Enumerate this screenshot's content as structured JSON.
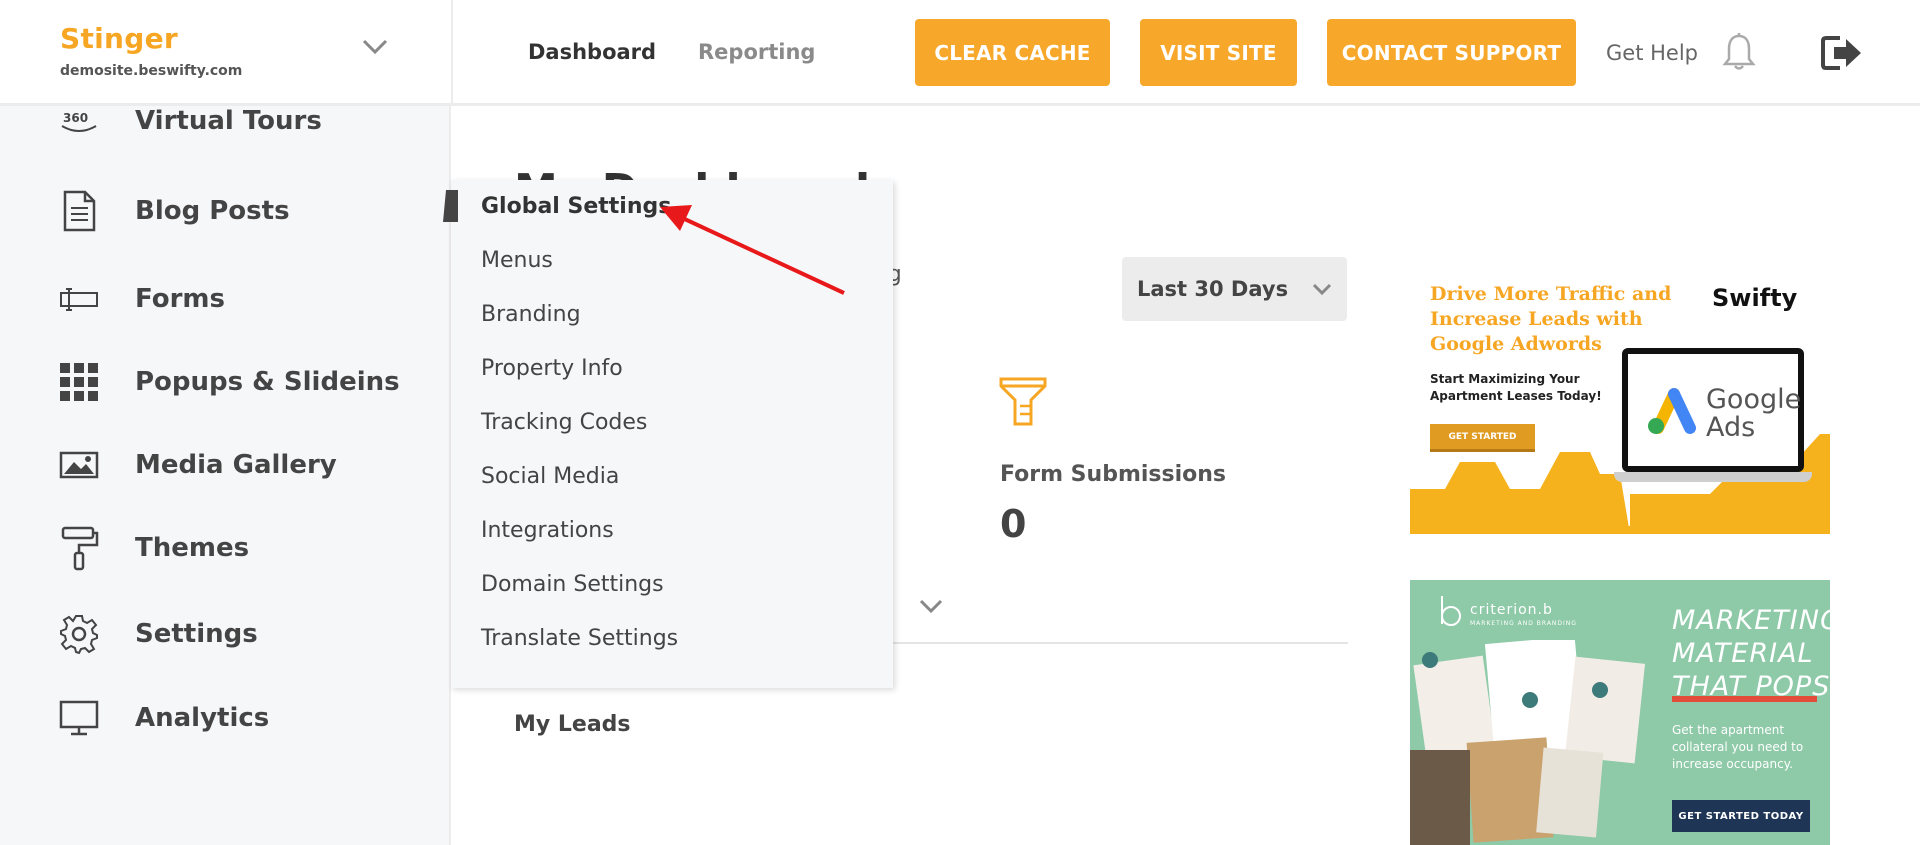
{
  "brand": {
    "name": "Stinger",
    "domain": "demosite.beswifty.com"
  },
  "topnav": {
    "dashboard": "Dashboard",
    "reporting": "Reporting"
  },
  "toolbar": {
    "clear_cache": "CLEAR CACHE",
    "visit_site": "VISIT SITE",
    "contact_support": "CONTACT SUPPORT",
    "get_help": "Get Help"
  },
  "sidebar": {
    "items": [
      {
        "label": "Virtual Tours",
        "icon": "360-icon"
      },
      {
        "label": "Blog Posts",
        "icon": "document-icon"
      },
      {
        "label": "Forms",
        "icon": "form-field-icon"
      },
      {
        "label": "Popups & Slideins",
        "icon": "grid-icon"
      },
      {
        "label": "Media Gallery",
        "icon": "image-icon"
      },
      {
        "label": "Themes",
        "icon": "paint-roller-icon"
      },
      {
        "label": "Settings",
        "icon": "gear-icon"
      },
      {
        "label": "Analytics",
        "icon": "monitor-icon"
      }
    ]
  },
  "settings_menu": {
    "items": [
      "Global Settings",
      "Menus",
      "Branding",
      "Property Info",
      "Tracking Codes",
      "Social Media",
      "Integrations",
      "Domain Settings",
      "Translate Settings"
    ],
    "active": "Global Settings"
  },
  "main": {
    "page_title": "My Dashboard",
    "reporting_partial": "rting",
    "range": {
      "selected": "Last 30 Days"
    },
    "stat": {
      "label": "Form Submissions",
      "value": "0"
    },
    "my_leads": "My Leads"
  },
  "ads": {
    "google": {
      "headline": "Drive More Traffic and Increase Leads with Google Adwords",
      "subhead": "Start Maximizing Your Apartment Leases Today!",
      "button": "GET STARTED",
      "logo": "Swifty",
      "product": "Google Ads"
    },
    "criterion": {
      "brand": "criterion.b",
      "brand_sub": "MARKETING AND BRANDING",
      "title": "MARKETING MATERIAL THAT POPS",
      "text": "Get the apartment collateral you need to increase occupancy.",
      "button": "GET STARTED TODAY"
    }
  },
  "colors": {
    "accent": "#f7a82a",
    "brand": "#f6a623",
    "annotation": "#e8191a",
    "ad2_bg": "#8ec9a8"
  }
}
